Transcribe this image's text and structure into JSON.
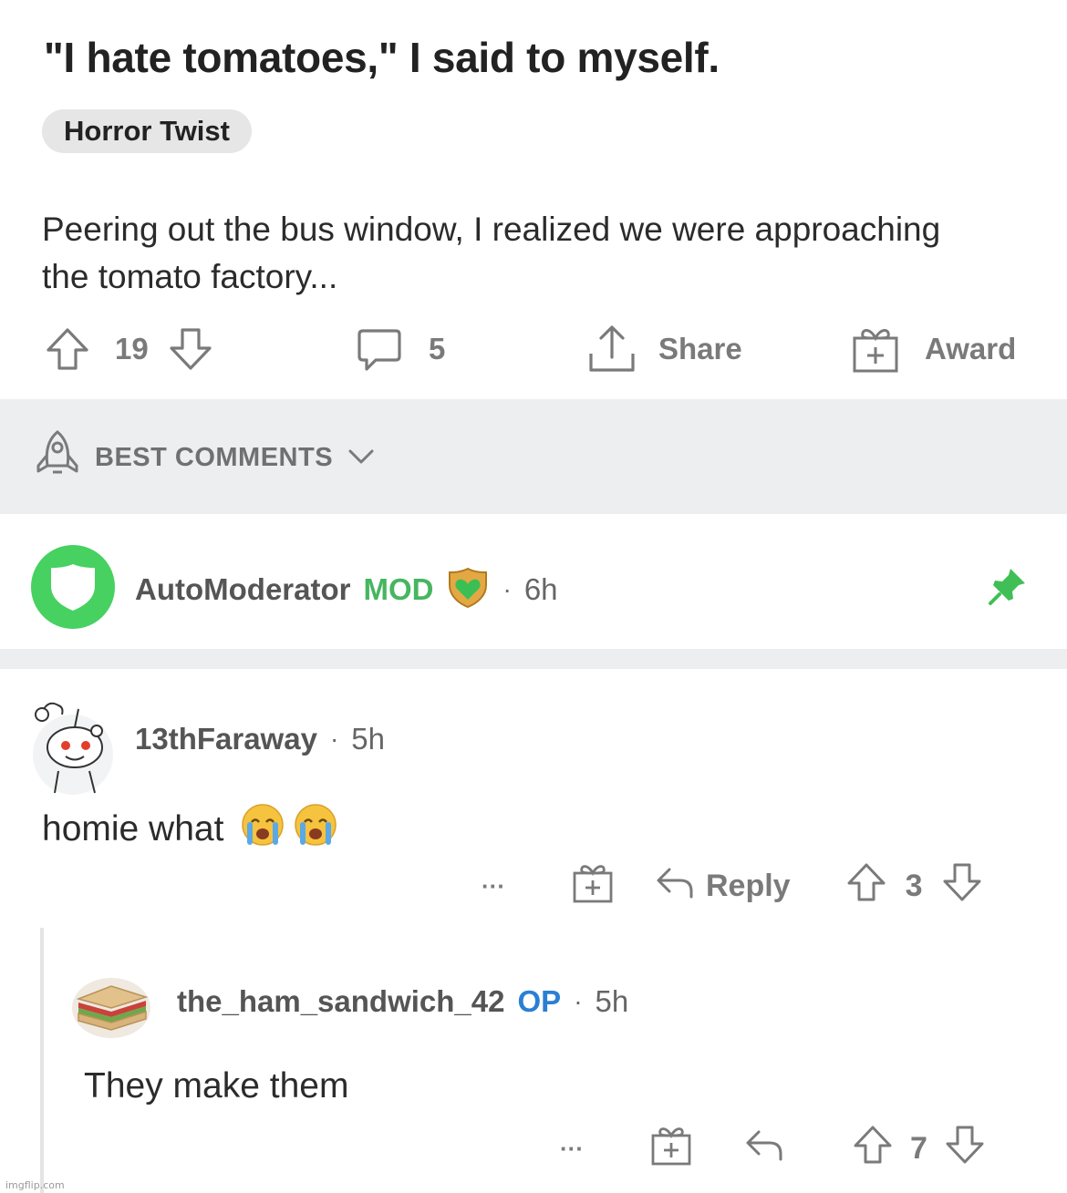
{
  "post": {
    "title": "\"I hate tomatoes,\" I said to myself.",
    "flair": "Horror Twist",
    "body": "Peering out the bus window, I realized we were approaching the tomato factory...",
    "upvotes": "19",
    "comments": "5",
    "share_label": "Share",
    "award_label": "Award"
  },
  "sort": {
    "label": "BEST COMMENTS"
  },
  "comments": [
    {
      "username": "AutoModerator",
      "tag": "MOD",
      "separator": "·",
      "time": "6h",
      "pinned": true,
      "accent_color": "#46d160"
    },
    {
      "username": "13thFaraway",
      "separator": "·",
      "time": "5h",
      "text": "homie what",
      "more": "···",
      "reply_label": "Reply",
      "score": "3"
    },
    {
      "username": "the_ham_sandwich_42",
      "tag": "OP",
      "separator": "·",
      "time": "5h",
      "text": "They make them",
      "more": "···",
      "score": "7"
    }
  ],
  "icons": {
    "upvote": "arrow-up-outline-icon",
    "downvote": "arrow-down-outline-icon",
    "comment": "speech-bubble-icon",
    "share": "share-upload-icon",
    "award": "gift-box-icon",
    "sort": "rocket-icon",
    "pin": "pin-icon",
    "reply": "reply-arrow-icon",
    "emoji": "loudly-crying-face-emoji"
  },
  "watermark": "imgflip.com"
}
